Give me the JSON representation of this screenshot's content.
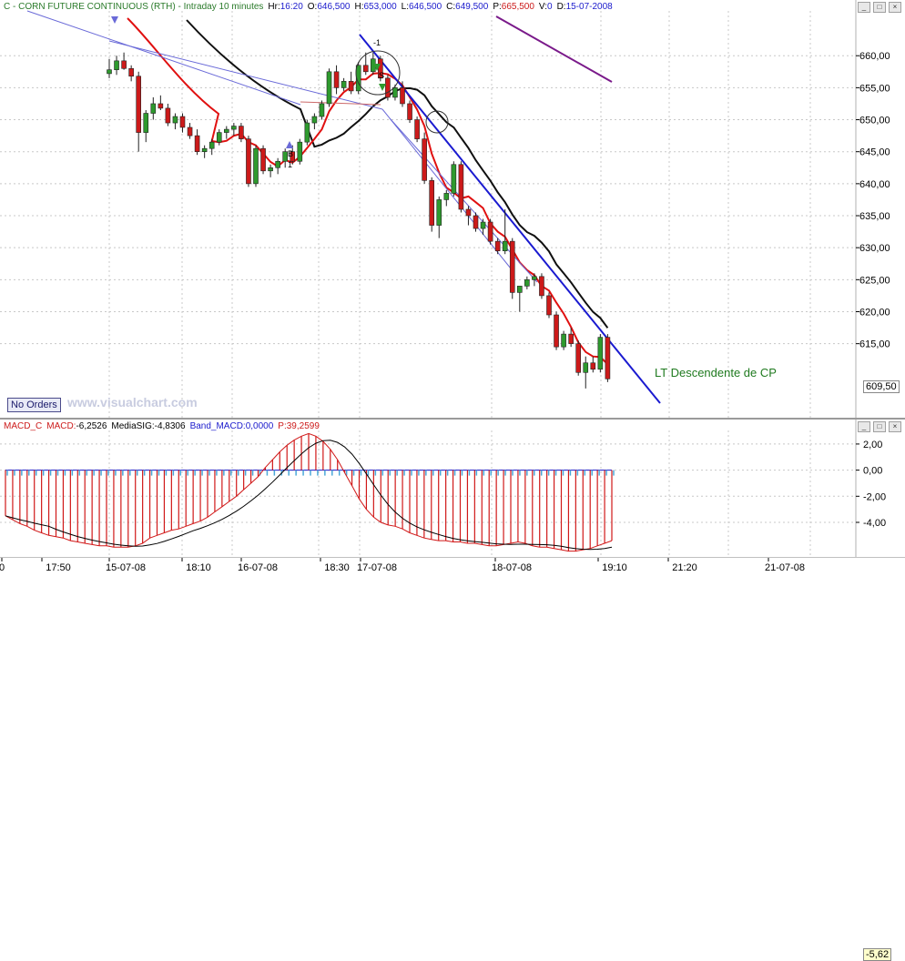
{
  "header": {
    "symbol": "C - CORN FUTURE CONTINUOUS (RTH) - Intraday 10 minutes",
    "hr_label": "Hr:",
    "hr_value": "16:20",
    "o_label": "O:",
    "o_value": "646,500",
    "h_label": "H:",
    "h_value": "653,000",
    "l_label": "L:",
    "l_value": "646,500",
    "c_label": "C:",
    "c_value": "649,500",
    "p_label": "P:",
    "p_value": "665,500",
    "v_label": "V:",
    "v_value": "0",
    "d_label": "D:",
    "d_value": "15-07-2008"
  },
  "macd_header": {
    "name": "MACD_C",
    "macd_label": "MACD:",
    "macd_value": "-6,2526",
    "sig_label": "MediaSIG:",
    "sig_value": "-4,8306",
    "band_label": "Band_MACD:",
    "band_value": "0,0000",
    "p_label": "P:",
    "p_value": "39,2599"
  },
  "no_orders": "No Orders",
  "watermark": "www.visualchart.com",
  "annotation": "LT Descendente de CP",
  "last_price": "609,50",
  "last_macd": "-5,62",
  "chart_data": {
    "type": "candlestick",
    "price_axis": {
      "ticks": [
        "660,00",
        "655,00",
        "650,00",
        "645,00",
        "640,00",
        "635,00",
        "630,00",
        "625,00",
        "620,00",
        "615,00"
      ],
      "ylim": [
        604,
        667
      ]
    },
    "macd_axis": {
      "ticks": [
        "2,00",
        "0,00",
        "-2,00",
        "-4,00"
      ],
      "ylim": [
        -6.3,
        2.9
      ]
    },
    "time_axis": {
      "ticks": [
        "0",
        "17:50",
        "15-07-08",
        "18:10",
        "16-07-08",
        "18:30",
        "17-07-08",
        "18-07-08",
        "19:10",
        "21:20",
        "21-07-08"
      ]
    },
    "candles": [
      [
        657.2,
        659.5,
        656.5,
        657.8
      ],
      [
        657.8,
        660.0,
        657.0,
        659.2
      ],
      [
        659.2,
        660.5,
        657.8,
        658.0
      ],
      [
        658.0,
        658.5,
        656.0,
        656.8
      ],
      [
        656.8,
        657.5,
        645.0,
        648.0
      ],
      [
        648.0,
        651.5,
        646.5,
        651.0
      ],
      [
        651.0,
        653.5,
        650.0,
        652.5
      ],
      [
        652.5,
        653.8,
        651.5,
        651.8
      ],
      [
        651.8,
        652.5,
        649.0,
        649.5
      ],
      [
        649.5,
        651.0,
        648.5,
        650.5
      ],
      [
        650.5,
        651.0,
        648.0,
        648.8
      ],
      [
        648.8,
        649.5,
        647.0,
        647.5
      ],
      [
        647.5,
        648.5,
        644.5,
        645.0
      ],
      [
        645.0,
        646.0,
        644.0,
        645.5
      ],
      [
        645.5,
        647.0,
        644.5,
        646.5
      ],
      [
        646.5,
        648.5,
        646.0,
        648.0
      ],
      [
        648.0,
        649.0,
        647.0,
        648.5
      ],
      [
        648.5,
        649.5,
        647.5,
        649.0
      ],
      [
        649.0,
        649.5,
        646.5,
        647.0
      ],
      [
        647.0,
        647.5,
        639.5,
        640.0
      ],
      [
        640.0,
        646.0,
        639.5,
        645.5
      ],
      [
        645.5,
        646.0,
        641.5,
        642.0
      ],
      [
        642.0,
        643.0,
        641.0,
        642.5
      ],
      [
        642.5,
        644.0,
        641.5,
        643.5
      ],
      [
        643.5,
        645.5,
        642.5,
        645.0
      ],
      [
        645.0,
        646.0,
        643.0,
        643.5
      ],
      [
        643.5,
        647.0,
        643.0,
        646.5
      ],
      [
        646.5,
        650.0,
        646.0,
        649.5
      ],
      [
        649.5,
        651.0,
        648.5,
        650.5
      ],
      [
        650.5,
        653.0,
        650.0,
        652.5
      ],
      [
        652.5,
        658.0,
        652.0,
        657.5
      ],
      [
        657.5,
        658.5,
        654.0,
        655.0
      ],
      [
        655.0,
        656.5,
        654.5,
        656.0
      ],
      [
        656.0,
        657.5,
        654.0,
        654.5
      ],
      [
        654.5,
        659.0,
        654.0,
        658.5
      ],
      [
        658.5,
        660.5,
        657.0,
        657.5
      ],
      [
        657.5,
        660.5,
        657.0,
        659.5
      ],
      [
        659.5,
        660.0,
        656.0,
        656.5
      ],
      [
        656.5,
        657.0,
        653.0,
        653.5
      ],
      [
        653.5,
        655.5,
        653.0,
        655.0
      ],
      [
        655.0,
        656.0,
        652.0,
        652.5
      ],
      [
        652.5,
        653.0,
        649.5,
        650.0
      ],
      [
        650.0,
        650.5,
        646.5,
        647.0
      ],
      [
        647.0,
        648.0,
        640.0,
        640.5
      ],
      [
        640.5,
        641.0,
        632.5,
        633.5
      ],
      [
        633.5,
        638.0,
        631.5,
        637.5
      ],
      [
        637.5,
        639.0,
        636.5,
        638.5
      ],
      [
        638.5,
        643.5,
        638.0,
        643.0
      ],
      [
        643.0,
        643.5,
        635.5,
        636.0
      ],
      [
        636.0,
        636.5,
        633.5,
        635.0
      ],
      [
        635.0,
        635.5,
        632.5,
        633.0
      ],
      [
        633.0,
        634.5,
        632.0,
        634.0
      ],
      [
        634.0,
        634.5,
        630.5,
        631.0
      ],
      [
        631.0,
        631.5,
        629.0,
        629.5
      ],
      [
        629.5,
        636.0,
        629.0,
        631.0
      ],
      [
        631.0,
        631.5,
        622.0,
        623.0
      ],
      [
        623.0,
        623.5,
        620.0,
        624.0
      ],
      [
        624.0,
        625.5,
        623.5,
        625.0
      ],
      [
        625.0,
        626.0,
        624.0,
        625.5
      ],
      [
        625.5,
        626.0,
        622.0,
        622.5
      ],
      [
        622.5,
        623.0,
        619.0,
        619.5
      ],
      [
        619.5,
        620.0,
        614.0,
        614.5
      ],
      [
        614.5,
        617.0,
        614.0,
        616.5
      ],
      [
        616.5,
        617.5,
        614.5,
        615.0
      ],
      [
        615.0,
        615.5,
        610.0,
        610.5
      ],
      [
        610.5,
        613.0,
        608.0,
        612.0
      ],
      [
        612.0,
        613.0,
        610.5,
        611.0
      ],
      [
        611.0,
        616.5,
        610.5,
        616.0
      ],
      [
        616.0,
        616.5,
        609.0,
        609.5
      ]
    ],
    "macd_hist": [
      -3.5,
      -3.8,
      -4.1,
      -4.3,
      -4.6,
      -4.8,
      -5.0,
      -5.1,
      -5.2,
      -5.4,
      -5.5,
      -5.6,
      -5.7,
      -5.8,
      -5.8,
      -5.9,
      -5.9,
      -5.9,
      -5.8,
      -5.6,
      -5.2,
      -5.0,
      -4.8,
      -4.6,
      -4.5,
      -4.3,
      -4.1,
      -3.9,
      -3.6,
      -3.2,
      -2.8,
      -2.4,
      -2.0,
      -1.5,
      -1.0,
      -0.5,
      0.2,
      0.8,
      1.4,
      1.9,
      2.3,
      2.6,
      2.8,
      2.6,
      2.2,
      1.6,
      0.8,
      -0.2,
      -1.2,
      -2.2,
      -3.0,
      -3.6,
      -4.0,
      -4.2,
      -4.3,
      -4.5,
      -4.8,
      -5.0,
      -5.2,
      -5.3,
      -5.4,
      -5.4,
      -5.5,
      -5.5,
      -5.6,
      -5.6,
      -5.7,
      -5.8,
      -5.8,
      -5.7,
      -5.6,
      -5.5,
      -5.6,
      -5.8,
      -5.9,
      -5.9,
      -6.0,
      -6.1,
      -6.2,
      -6.2,
      -6.1,
      -6.0,
      -5.8,
      -5.6,
      -5.4
    ]
  },
  "colors": {
    "bull": "#2e9a2e",
    "bear": "#cc1a1a",
    "ma_red": "#e01010",
    "ma_black": "#101010",
    "ma_purple": "#7a1a8a",
    "trend_blue": "#1a1ad0",
    "hist_red": "#d01818",
    "hist_blue": "#4aa8d8"
  }
}
